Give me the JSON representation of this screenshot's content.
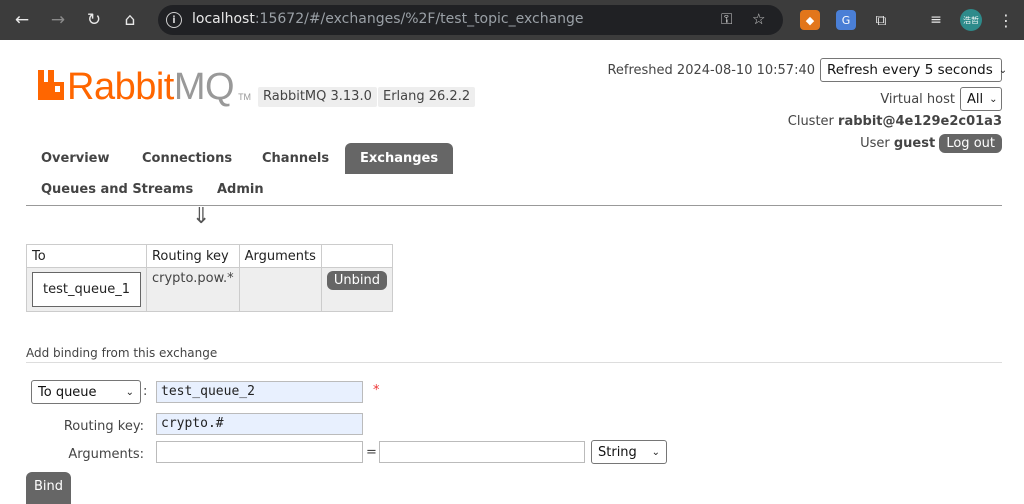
{
  "browser": {
    "url_host": "localhost",
    "url_rest": ":15672/#/exchanges/%2F/test_topic_exchange",
    "avatar_text": "浩哲"
  },
  "app": {
    "logo_brand": "Rabbit",
    "logo_suffix": "MQ",
    "logo_tm": "TM",
    "rabbitmq_version": "RabbitMQ 3.13.0",
    "erlang_version": "Erlang 26.2.2",
    "brand_color": "#ff6600"
  },
  "header": {
    "refreshed_label": "Refreshed 2024-08-10 10:57:40",
    "refresh_select": "Refresh every 5 seconds",
    "vhost_label": "Virtual host",
    "vhost_select": "All",
    "cluster_label": "Cluster",
    "cluster_name": "rabbit@4e129e2c01a3",
    "user_label": "User",
    "user_name": "guest",
    "logout_label": "Log out"
  },
  "tabs": [
    {
      "label": "Overview",
      "active": false
    },
    {
      "label": "Connections",
      "active": false
    },
    {
      "label": "Channels",
      "active": false
    },
    {
      "label": "Exchanges",
      "active": true
    },
    {
      "label": "Queues and Streams",
      "active": false
    },
    {
      "label": "Admin",
      "active": false
    }
  ],
  "bindings": {
    "arrow": "⇓",
    "headers": [
      "To",
      "Routing key",
      "Arguments",
      ""
    ],
    "rows": [
      {
        "to": "test_queue_1",
        "routing_key": "crypto.pow.*",
        "arguments": "",
        "action": "Unbind"
      }
    ]
  },
  "add_binding": {
    "title": "Add binding from this exchange",
    "dest_type_select": "To queue",
    "colon": ":",
    "dest_value": "test_queue_2",
    "required_mark": "*",
    "routing_key_label": "Routing key:",
    "routing_key_value": "crypto.#",
    "arguments_label": "Arguments:",
    "equals": "=",
    "arg_type_select": "String",
    "bind_label": "Bind"
  }
}
